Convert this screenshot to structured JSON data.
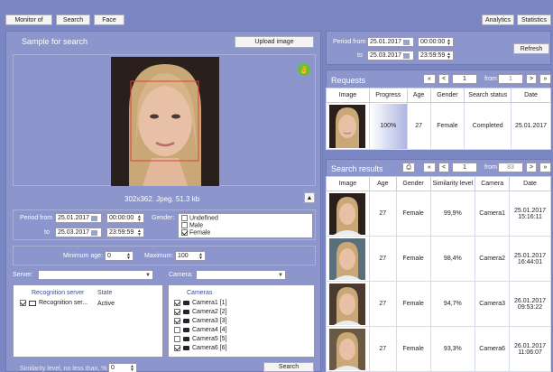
{
  "topbar": {
    "tabs": [
      "Monitor of",
      "Search",
      "Face"
    ],
    "right_tabs": [
      "Analytics",
      "Statistics"
    ]
  },
  "sample": {
    "title": "Sample for search",
    "upload_label": "Upload image",
    "image_info": "302x362. Jpeg. 51.3 kb"
  },
  "filter": {
    "period_from_label": "Period from",
    "to_label": "to",
    "date_from": "25.01.2017",
    "time_from": "00:00:00",
    "date_to": "25.03.2017",
    "time_to": "23:59:59",
    "gender_label": "Gender:",
    "genders": [
      {
        "label": "Undefined",
        "checked": false
      },
      {
        "label": "Male",
        "checked": false
      },
      {
        "label": "Female",
        "checked": true
      }
    ],
    "min_age_label": "Minimum age:",
    "min_age": "0",
    "max_age_label": "Maximum:",
    "max_age": "100",
    "server_label": "Server:",
    "camera_label": "Camera:",
    "servers_header": {
      "name": "Recognition server",
      "state": "State"
    },
    "servers": [
      {
        "name": "Recognition ser...",
        "state": "Active",
        "checked": true
      }
    ],
    "cameras_header": "Cameras",
    "cameras": [
      {
        "label": "Camera1 [1]",
        "checked": true
      },
      {
        "label": "Camera2 [2]",
        "checked": true
      },
      {
        "label": "Camera3 [3]",
        "checked": true
      },
      {
        "label": "Camera4 [4]",
        "checked": false
      },
      {
        "label": "Camera5 [5]",
        "checked": false
      },
      {
        "label": "Camera6 [6]",
        "checked": true
      }
    ],
    "similarity_label": "Similarity level, no less than, %",
    "similarity": "0",
    "search_label": "Search"
  },
  "requests_panel": {
    "period_from_label": "Period from",
    "to_label": "to",
    "date_from": "25.01.2017",
    "time_from": "00:00:00",
    "date_to": "25.03.2017",
    "time_to": "23:59:59",
    "refresh_label": "Refresh",
    "title": "Requests",
    "page": "1",
    "from_label": "from",
    "total": "1",
    "columns": [
      "Image",
      "Progress",
      "Age",
      "Gender",
      "Search status",
      "Date"
    ],
    "rows": [
      {
        "progress": "100%",
        "progress_value": 1.0,
        "age": "27",
        "gender": "Female",
        "status": "Completed",
        "date": "25.01.2017"
      }
    ]
  },
  "results_panel": {
    "title": "Search results",
    "page": "1",
    "from_label": "from",
    "total": "83",
    "columns": [
      "Image",
      "Age",
      "Gender",
      "Similarity level",
      "Camera",
      "Date"
    ],
    "rows": [
      {
        "age": "27",
        "gender": "Female",
        "similarity": "99,9%",
        "camera": "Camera1",
        "date": "25.01.2017",
        "time": "15:16:11"
      },
      {
        "age": "27",
        "gender": "Female",
        "similarity": "98,4%",
        "camera": "Camera2",
        "date": "25.01.2017",
        "time": "16:44:01"
      },
      {
        "age": "27",
        "gender": "Female",
        "similarity": "94,7%",
        "camera": "Camera3",
        "date": "26.01.2017",
        "time": "09:53:22"
      },
      {
        "age": "27",
        "gender": "Female",
        "similarity": "93,3%",
        "camera": "Camera6",
        "date": "26.01.2017",
        "time": "11:06:07"
      }
    ]
  },
  "nav": {
    "first": "«",
    "prev": "<",
    "next": ">",
    "last": "»"
  },
  "colors": {
    "background": "#7a86c2",
    "panel": "#8c96cc",
    "accent_green": "#6abf3a"
  }
}
